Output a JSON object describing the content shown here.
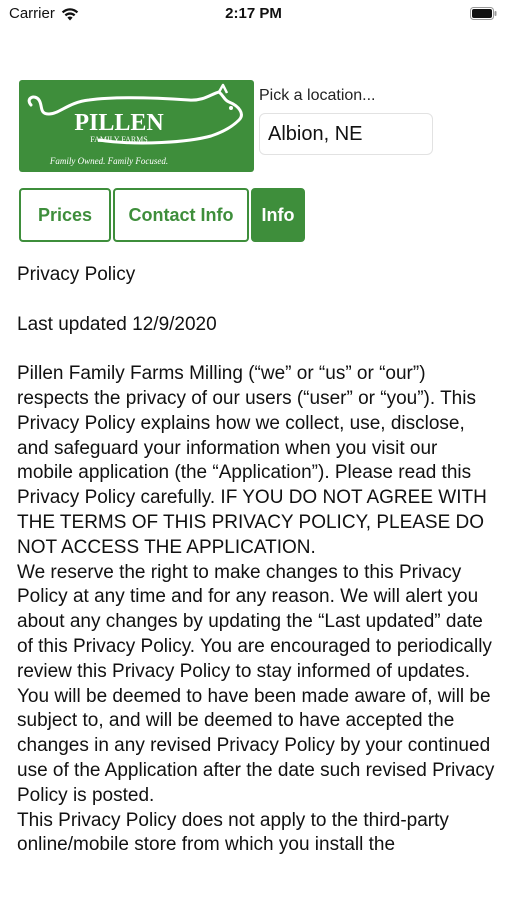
{
  "status_bar": {
    "carrier": "Carrier",
    "time": "2:17 PM"
  },
  "header": {
    "logo": {
      "name": "PILLEN",
      "sub": "FAMILY FARMS",
      "tagline": "Family Owned. Family Focused."
    },
    "picker_label": "Pick a location...",
    "location_value": "Albion, NE"
  },
  "tabs": [
    {
      "label": "Prices",
      "active": false
    },
    {
      "label": "Contact Info",
      "active": false
    },
    {
      "label": "Info",
      "active": true
    }
  ],
  "policy": {
    "title": "Privacy Policy",
    "last_updated": "Last updated 12/9/2020",
    "paragraphs": [
      "Pillen Family Farms Milling (“we” or “us” or “our”) respects the privacy of our users (“user” or “you”). This Privacy Policy explains how we collect, use, disclose, and safeguard your information when you visit our mobile application (the “Application”). Please read this Privacy Policy carefully. IF YOU DO NOT AGREE WITH THE TERMS OF THIS PRIVACY POLICY, PLEASE DO NOT ACCESS THE APPLICATION.",
      "We reserve the right to make changes to this Privacy Policy at any time and for any reason. We will alert you about any changes by updating the “Last updated” date of this Privacy Policy. You are encouraged to periodically review this Privacy Policy to stay informed of updates. You will be deemed to have been made aware of, will be subject to, and will be deemed to have accepted the changes in any revised Privacy Policy by your continued use of the Application after the date such revised Privacy Policy is posted.",
      "This Privacy Policy does not apply to the third-party online/mobile store from which you install the"
    ]
  },
  "colors": {
    "brand_green": "#3e8e3b"
  }
}
